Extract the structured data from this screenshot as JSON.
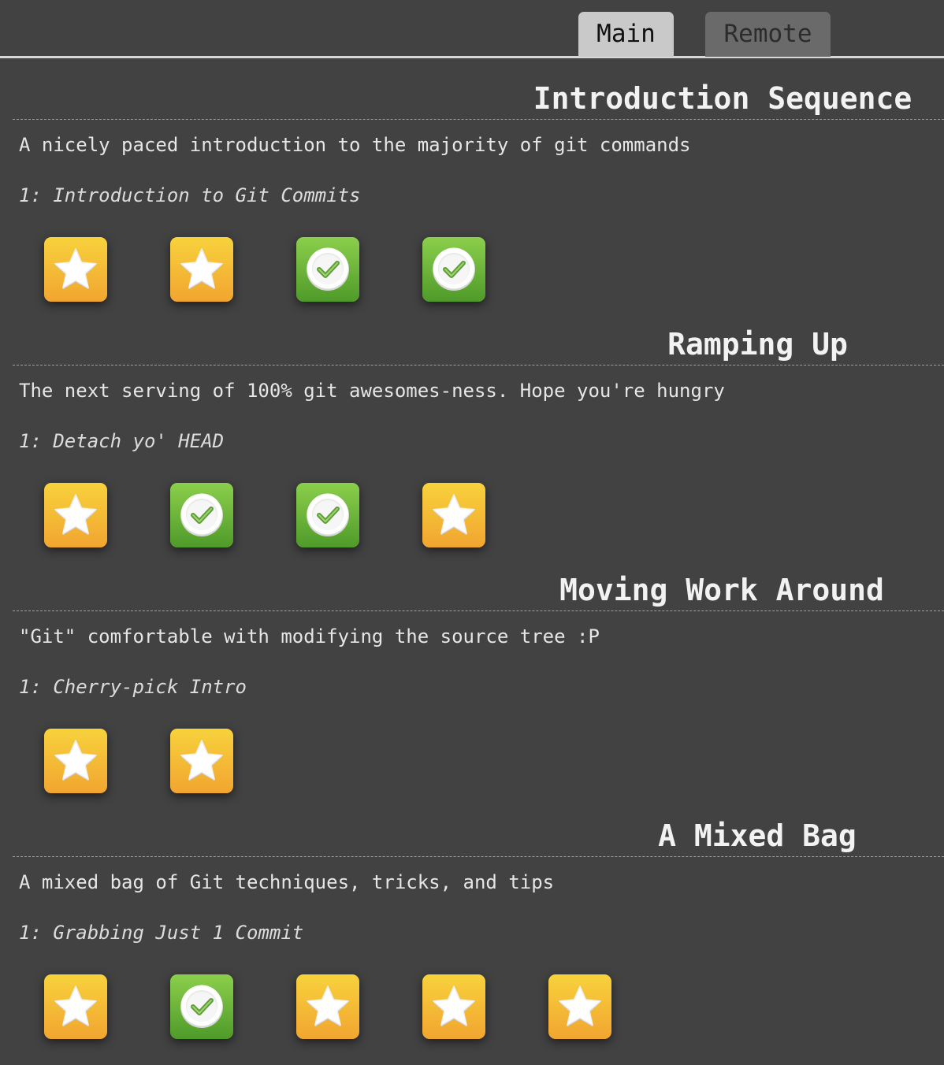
{
  "tabs": [
    {
      "label": "Main",
      "active": true
    },
    {
      "label": "Remote",
      "active": false
    }
  ],
  "sections": [
    {
      "title": "Introduction Sequence",
      "about": "A nicely paced introduction to the majority of git commands",
      "current": "1: Introduction to Git Commits",
      "levels": [
        "star",
        "star",
        "check",
        "check"
      ]
    },
    {
      "title": "Ramping Up",
      "about": "The next serving of 100% git awesomes-ness. Hope you're hungry",
      "current": "1: Detach yo' HEAD",
      "levels": [
        "star",
        "check",
        "check",
        "star"
      ]
    },
    {
      "title": "Moving Work Around",
      "about": "\"Git\" comfortable with modifying the source tree :P",
      "current": "1: Cherry-pick Intro",
      "levels": [
        "star",
        "star"
      ]
    },
    {
      "title": "A Mixed Bag",
      "about": "A mixed bag of Git techniques, tricks, and tips",
      "current": "1: Grabbing Just 1 Commit",
      "levels": [
        "star",
        "check",
        "star",
        "star",
        "star"
      ]
    }
  ],
  "colors": {
    "background": "#424242",
    "star_tile": "#f4b835",
    "check_tile": "#6cb53a",
    "text": "#e6e6e6"
  },
  "icons": {
    "star": "star-icon",
    "check": "checkmark-icon"
  }
}
